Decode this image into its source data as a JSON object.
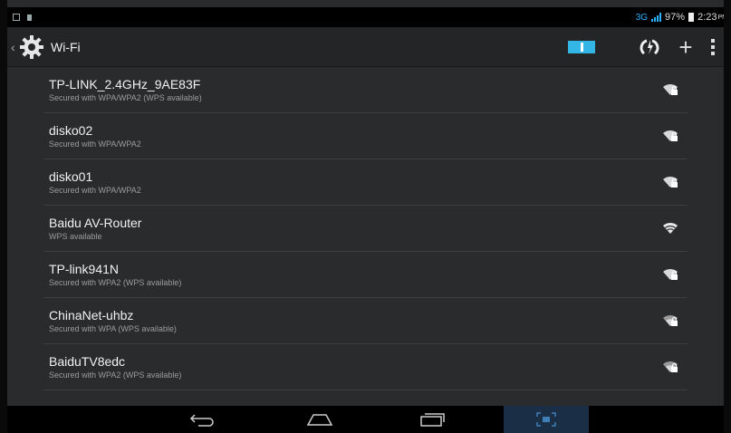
{
  "status_bar": {
    "network": "3G",
    "battery": "97%",
    "time": "2:23",
    "time_suffix": "PM"
  },
  "action_bar": {
    "title": "Wi-Fi",
    "toggle_state": "on",
    "wps_label": "WPS",
    "add_label": "+"
  },
  "networks": [
    {
      "ssid": "TP-LINK_2.4GHz_9AE83F",
      "security": "Secured with WPA/WPA2 (WPS available)",
      "locked": true
    },
    {
      "ssid": "disko02",
      "security": "Secured with WPA/WPA2",
      "locked": true
    },
    {
      "ssid": "disko01",
      "security": "Secured with WPA/WPA2",
      "locked": true
    },
    {
      "ssid": "Baidu AV-Router",
      "security": "WPS available",
      "locked": false
    },
    {
      "ssid": "TP-link941N",
      "security": "Secured with WPA2 (WPS available)",
      "locked": true
    },
    {
      "ssid": "ChinaNet-uhbz",
      "security": "Secured with WPA (WPS available)",
      "locked": true
    },
    {
      "ssid": "BaiduTV8edc",
      "security": "Secured with WPA2 (WPS available)",
      "locked": true
    }
  ],
  "colors": {
    "accent": "#33b5e5",
    "background": "#2a2b2d"
  }
}
